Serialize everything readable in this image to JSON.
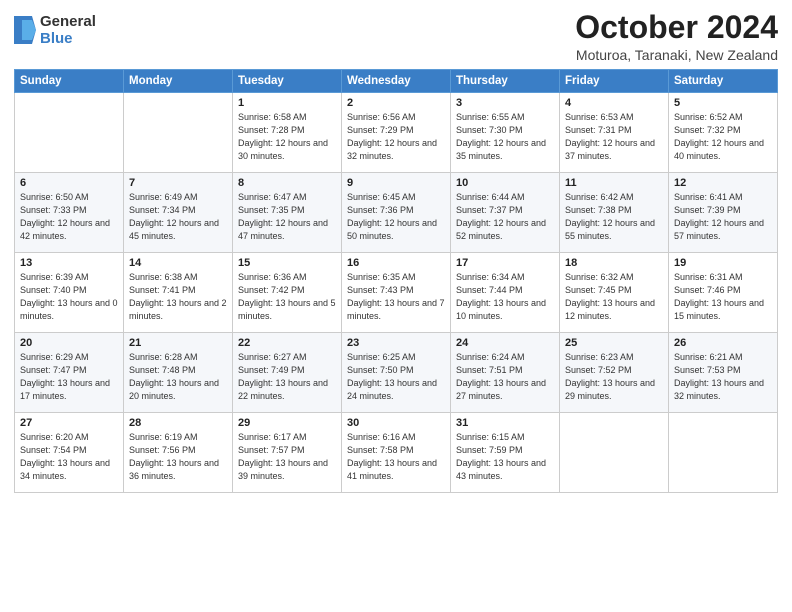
{
  "logo": {
    "general": "General",
    "blue": "Blue"
  },
  "header": {
    "title": "October 2024",
    "subtitle": "Moturoa, Taranaki, New Zealand"
  },
  "days_of_week": [
    "Sunday",
    "Monday",
    "Tuesday",
    "Wednesday",
    "Thursday",
    "Friday",
    "Saturday"
  ],
  "weeks": [
    [
      {
        "day": "",
        "sunrise": "",
        "sunset": "",
        "daylight": ""
      },
      {
        "day": "",
        "sunrise": "",
        "sunset": "",
        "daylight": ""
      },
      {
        "day": "1",
        "sunrise": "Sunrise: 6:58 AM",
        "sunset": "Sunset: 7:28 PM",
        "daylight": "Daylight: 12 hours and 30 minutes."
      },
      {
        "day": "2",
        "sunrise": "Sunrise: 6:56 AM",
        "sunset": "Sunset: 7:29 PM",
        "daylight": "Daylight: 12 hours and 32 minutes."
      },
      {
        "day": "3",
        "sunrise": "Sunrise: 6:55 AM",
        "sunset": "Sunset: 7:30 PM",
        "daylight": "Daylight: 12 hours and 35 minutes."
      },
      {
        "day": "4",
        "sunrise": "Sunrise: 6:53 AM",
        "sunset": "Sunset: 7:31 PM",
        "daylight": "Daylight: 12 hours and 37 minutes."
      },
      {
        "day": "5",
        "sunrise": "Sunrise: 6:52 AM",
        "sunset": "Sunset: 7:32 PM",
        "daylight": "Daylight: 12 hours and 40 minutes."
      }
    ],
    [
      {
        "day": "6",
        "sunrise": "Sunrise: 6:50 AM",
        "sunset": "Sunset: 7:33 PM",
        "daylight": "Daylight: 12 hours and 42 minutes."
      },
      {
        "day": "7",
        "sunrise": "Sunrise: 6:49 AM",
        "sunset": "Sunset: 7:34 PM",
        "daylight": "Daylight: 12 hours and 45 minutes."
      },
      {
        "day": "8",
        "sunrise": "Sunrise: 6:47 AM",
        "sunset": "Sunset: 7:35 PM",
        "daylight": "Daylight: 12 hours and 47 minutes."
      },
      {
        "day": "9",
        "sunrise": "Sunrise: 6:45 AM",
        "sunset": "Sunset: 7:36 PM",
        "daylight": "Daylight: 12 hours and 50 minutes."
      },
      {
        "day": "10",
        "sunrise": "Sunrise: 6:44 AM",
        "sunset": "Sunset: 7:37 PM",
        "daylight": "Daylight: 12 hours and 52 minutes."
      },
      {
        "day": "11",
        "sunrise": "Sunrise: 6:42 AM",
        "sunset": "Sunset: 7:38 PM",
        "daylight": "Daylight: 12 hours and 55 minutes."
      },
      {
        "day": "12",
        "sunrise": "Sunrise: 6:41 AM",
        "sunset": "Sunset: 7:39 PM",
        "daylight": "Daylight: 12 hours and 57 minutes."
      }
    ],
    [
      {
        "day": "13",
        "sunrise": "Sunrise: 6:39 AM",
        "sunset": "Sunset: 7:40 PM",
        "daylight": "Daylight: 13 hours and 0 minutes."
      },
      {
        "day": "14",
        "sunrise": "Sunrise: 6:38 AM",
        "sunset": "Sunset: 7:41 PM",
        "daylight": "Daylight: 13 hours and 2 minutes."
      },
      {
        "day": "15",
        "sunrise": "Sunrise: 6:36 AM",
        "sunset": "Sunset: 7:42 PM",
        "daylight": "Daylight: 13 hours and 5 minutes."
      },
      {
        "day": "16",
        "sunrise": "Sunrise: 6:35 AM",
        "sunset": "Sunset: 7:43 PM",
        "daylight": "Daylight: 13 hours and 7 minutes."
      },
      {
        "day": "17",
        "sunrise": "Sunrise: 6:34 AM",
        "sunset": "Sunset: 7:44 PM",
        "daylight": "Daylight: 13 hours and 10 minutes."
      },
      {
        "day": "18",
        "sunrise": "Sunrise: 6:32 AM",
        "sunset": "Sunset: 7:45 PM",
        "daylight": "Daylight: 13 hours and 12 minutes."
      },
      {
        "day": "19",
        "sunrise": "Sunrise: 6:31 AM",
        "sunset": "Sunset: 7:46 PM",
        "daylight": "Daylight: 13 hours and 15 minutes."
      }
    ],
    [
      {
        "day": "20",
        "sunrise": "Sunrise: 6:29 AM",
        "sunset": "Sunset: 7:47 PM",
        "daylight": "Daylight: 13 hours and 17 minutes."
      },
      {
        "day": "21",
        "sunrise": "Sunrise: 6:28 AM",
        "sunset": "Sunset: 7:48 PM",
        "daylight": "Daylight: 13 hours and 20 minutes."
      },
      {
        "day": "22",
        "sunrise": "Sunrise: 6:27 AM",
        "sunset": "Sunset: 7:49 PM",
        "daylight": "Daylight: 13 hours and 22 minutes."
      },
      {
        "day": "23",
        "sunrise": "Sunrise: 6:25 AM",
        "sunset": "Sunset: 7:50 PM",
        "daylight": "Daylight: 13 hours and 24 minutes."
      },
      {
        "day": "24",
        "sunrise": "Sunrise: 6:24 AM",
        "sunset": "Sunset: 7:51 PM",
        "daylight": "Daylight: 13 hours and 27 minutes."
      },
      {
        "day": "25",
        "sunrise": "Sunrise: 6:23 AM",
        "sunset": "Sunset: 7:52 PM",
        "daylight": "Daylight: 13 hours and 29 minutes."
      },
      {
        "day": "26",
        "sunrise": "Sunrise: 6:21 AM",
        "sunset": "Sunset: 7:53 PM",
        "daylight": "Daylight: 13 hours and 32 minutes."
      }
    ],
    [
      {
        "day": "27",
        "sunrise": "Sunrise: 6:20 AM",
        "sunset": "Sunset: 7:54 PM",
        "daylight": "Daylight: 13 hours and 34 minutes."
      },
      {
        "day": "28",
        "sunrise": "Sunrise: 6:19 AM",
        "sunset": "Sunset: 7:56 PM",
        "daylight": "Daylight: 13 hours and 36 minutes."
      },
      {
        "day": "29",
        "sunrise": "Sunrise: 6:17 AM",
        "sunset": "Sunset: 7:57 PM",
        "daylight": "Daylight: 13 hours and 39 minutes."
      },
      {
        "day": "30",
        "sunrise": "Sunrise: 6:16 AM",
        "sunset": "Sunset: 7:58 PM",
        "daylight": "Daylight: 13 hours and 41 minutes."
      },
      {
        "day": "31",
        "sunrise": "Sunrise: 6:15 AM",
        "sunset": "Sunset: 7:59 PM",
        "daylight": "Daylight: 13 hours and 43 minutes."
      },
      {
        "day": "",
        "sunrise": "",
        "sunset": "",
        "daylight": ""
      },
      {
        "day": "",
        "sunrise": "",
        "sunset": "",
        "daylight": ""
      }
    ]
  ]
}
